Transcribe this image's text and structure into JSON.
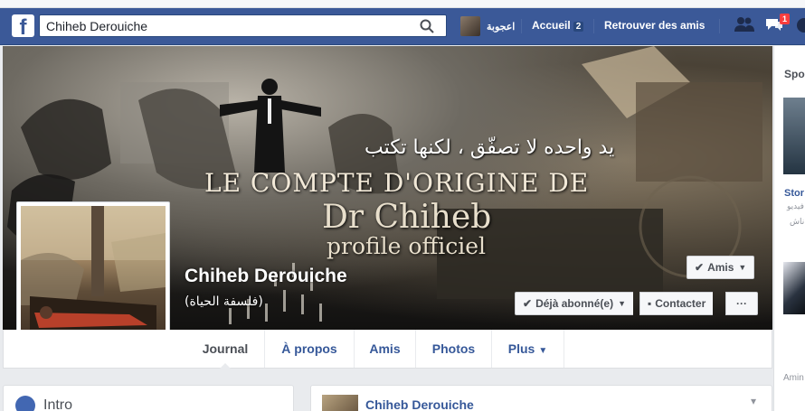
{
  "header": {
    "logo": "f",
    "search_value": "Chiheb Derouiche",
    "user_name": "اعجوبة",
    "accueil_label": "Accueil",
    "accueil_count": "2",
    "find_friends_label": "Retrouver des amis",
    "notifications_count": "1",
    "colors": {
      "bar": "#3b5998",
      "badge": "#fa3e3e"
    }
  },
  "cover": {
    "arabic_text": "يد واحده لا تصفّق ، لكنها تكتب",
    "line1": "LE COMPTE D'ORIGINE DE",
    "line2": "Dr Chiheb",
    "line3": "profile officiel"
  },
  "profile": {
    "name": "Chiheb Derouiche",
    "subtitle": "(فلسفة الحياة)"
  },
  "actions": {
    "friends_label": "Amis",
    "subscribed_label": "Déjà abonné(e)",
    "contact_label": "Contacter",
    "more_label": "···"
  },
  "tabs": [
    {
      "label": "Journal"
    },
    {
      "label": "À propos"
    },
    {
      "label": "Amis"
    },
    {
      "label": "Photos"
    },
    {
      "label": "Plus"
    }
  ],
  "intro": {
    "title": "Intro"
  },
  "post": {
    "author": "Chiheb Derouiche"
  },
  "right_column": {
    "sponsored": "Spo",
    "story_title": "Stor",
    "small1": "فيديو",
    "small2": "ناش",
    "footer": "Amin"
  }
}
